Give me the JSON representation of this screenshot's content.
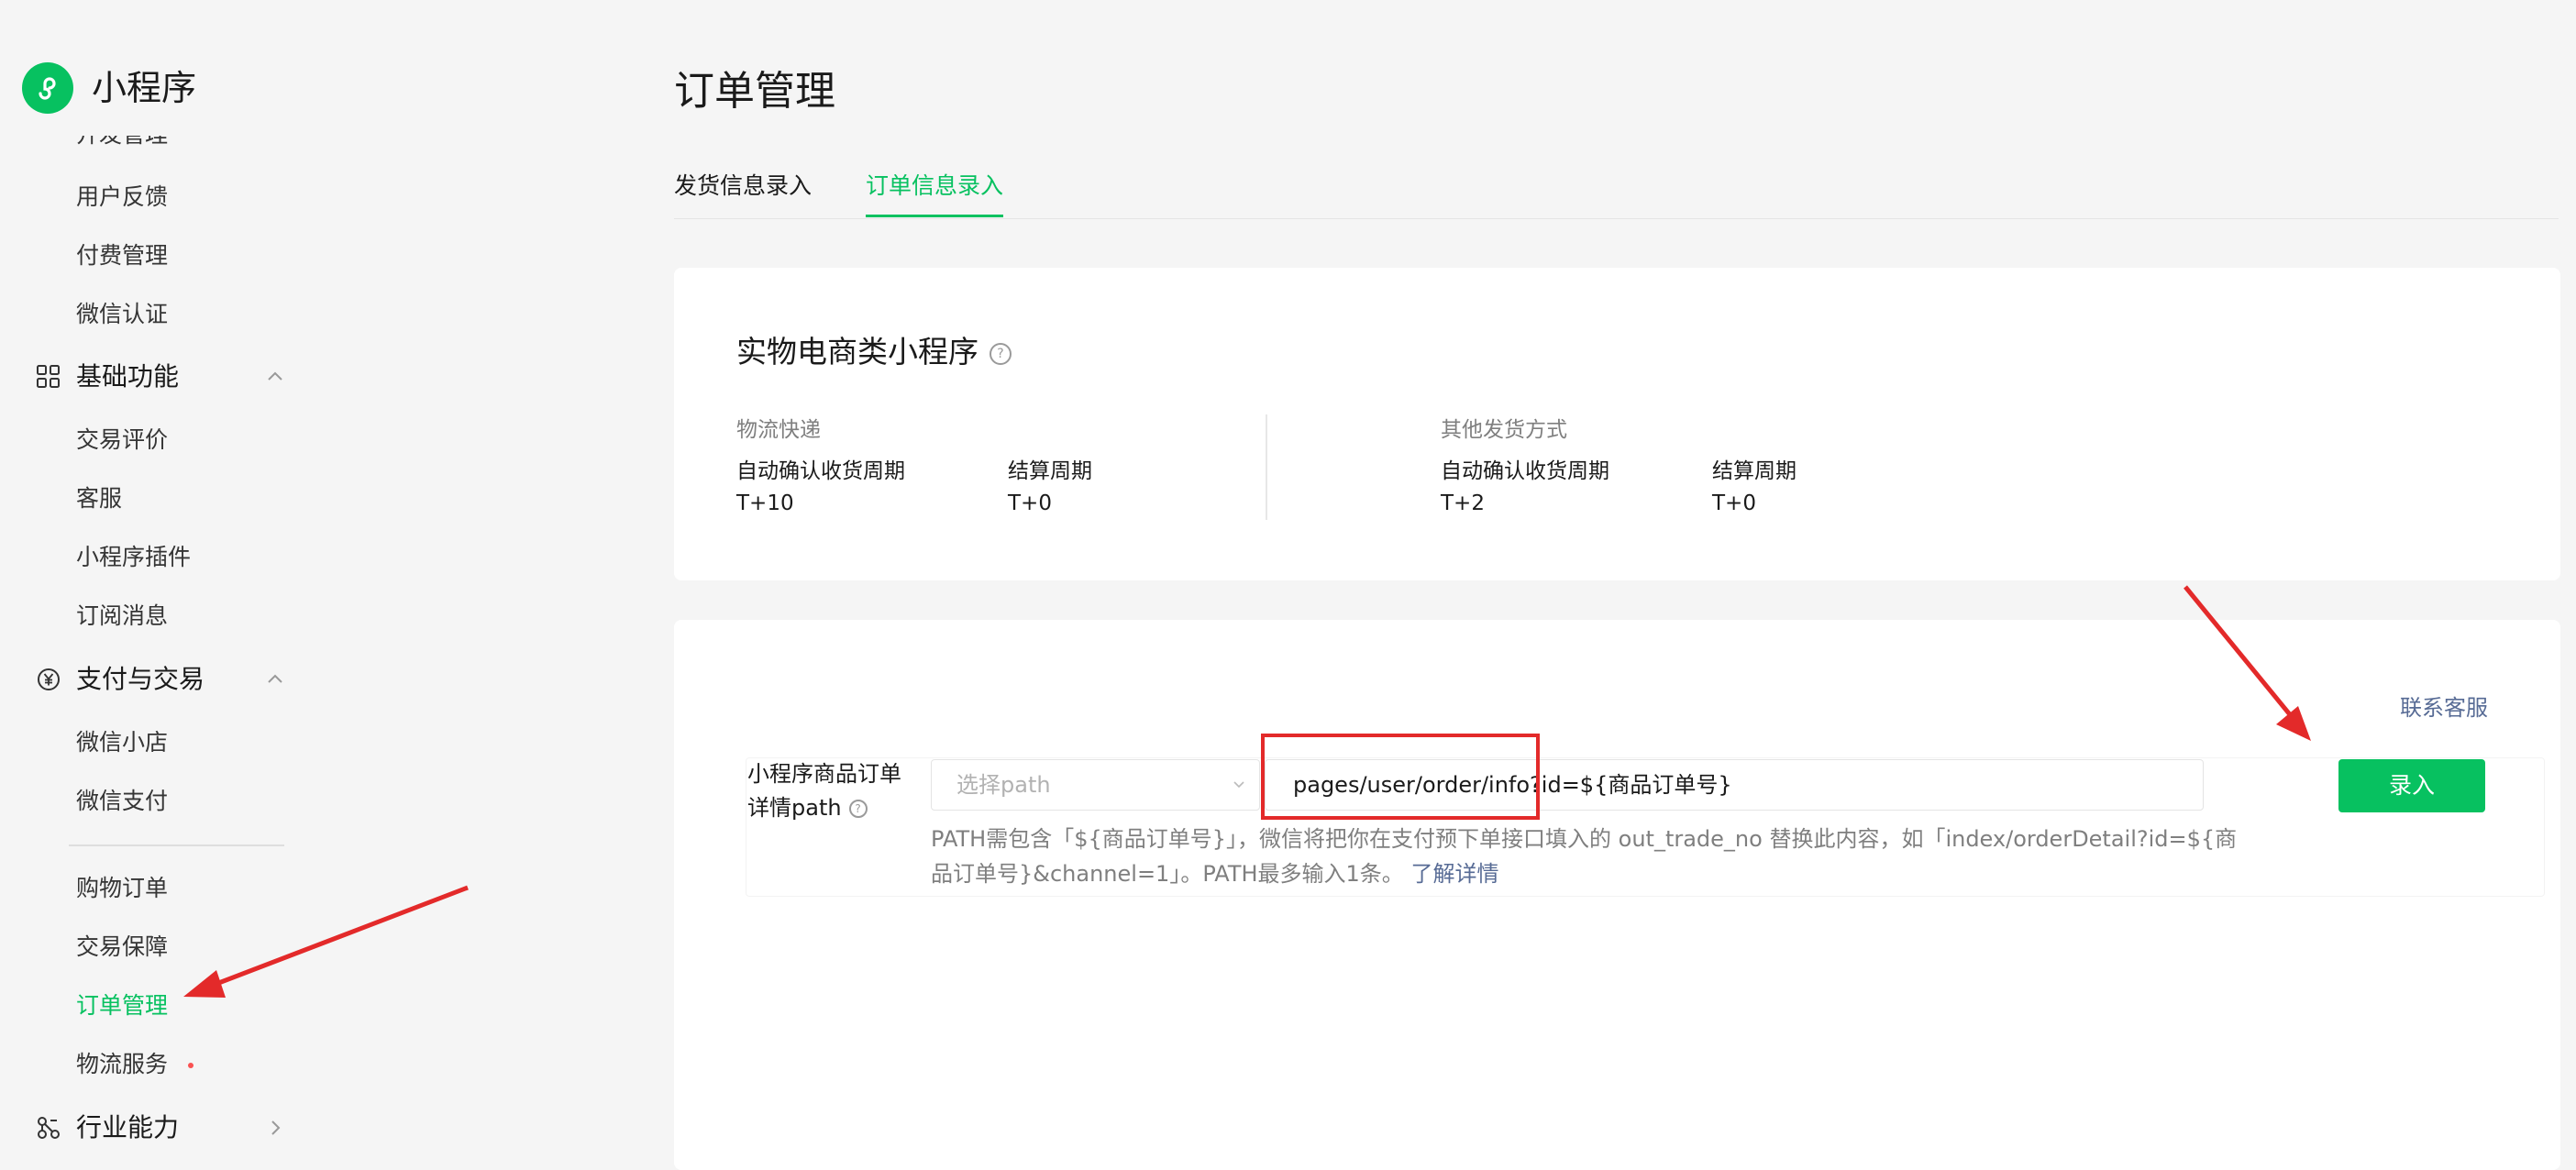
{
  "sidebar": {
    "app_title": "小程序",
    "clipped_item": "开发管理",
    "items_top": [
      "用户反馈",
      "付费管理",
      "微信认证"
    ],
    "groups": {
      "basic": "基础功能",
      "basic_items": [
        "交易评价",
        "客服",
        "小程序插件",
        "订阅消息"
      ],
      "pay": "支付与交易",
      "pay_items": [
        "微信小店",
        "微信支付"
      ],
      "pay_items2": [
        "购物订单",
        "交易保障",
        "订单管理",
        "物流服务"
      ],
      "industry": "行业能力"
    }
  },
  "main": {
    "title": "订单管理",
    "tabs": [
      "发货信息录入",
      "订单信息录入"
    ],
    "active_tab": "订单信息录入",
    "card1": {
      "title": "实物电商类小程序",
      "left": {
        "heading": "物流快递",
        "col1_label": "自动确认收货周期",
        "col1_value": "T+10",
        "col2_label": "结算周期",
        "col2_value": "T+0"
      },
      "right": {
        "heading": "其他发货方式",
        "col1_label": "自动确认收货周期",
        "col1_value": "T+2",
        "col2_label": "结算周期",
        "col2_value": "T+0"
      }
    },
    "card2": {
      "contact": "联系客服",
      "field_label_line1": "小程序商品订单",
      "field_label_line2": "详情path",
      "select_placeholder": "选择path",
      "path_value": "pages/user/order/info?id=${商品订单号}",
      "submit": "录入",
      "helper_text": "PATH需包含「${商品订单号}」，微信将把你在支付预下单接口填入的 out_trade_no 替换此内容，如「index/orderDetail?id=${商品订单号}&channel=1」。PATH最多输入1条。",
      "learn_more": "了解详情"
    }
  },
  "colors": {
    "brand_green": "#07c160",
    "link_blue": "#576b95",
    "annotation_red": "#e32a2a"
  }
}
